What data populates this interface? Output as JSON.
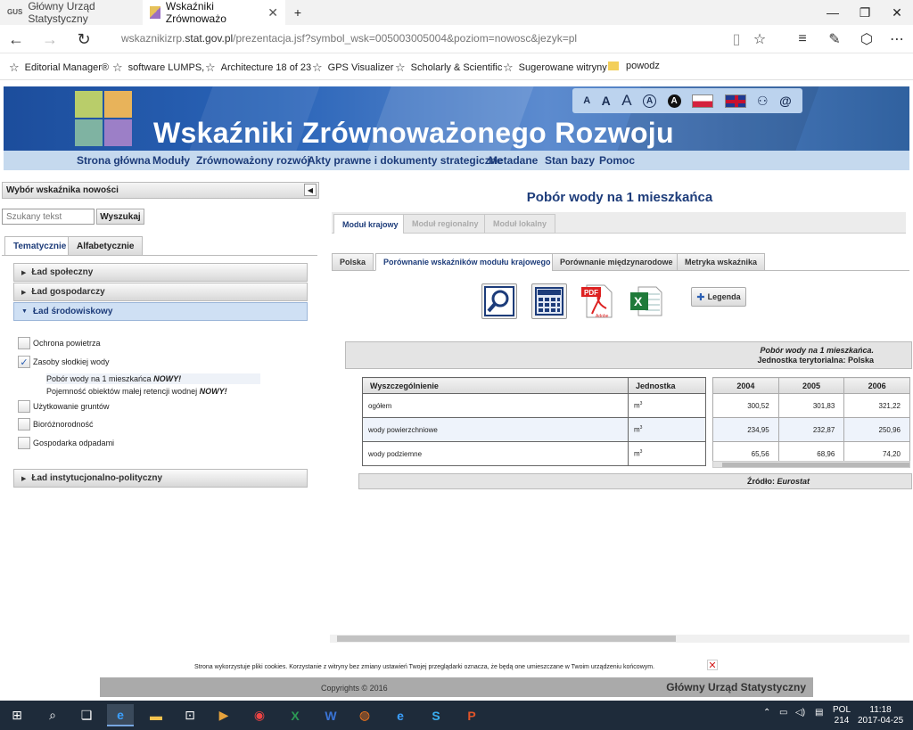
{
  "browser": {
    "tabs": [
      {
        "label": "Główny Urząd Statystyczny",
        "favicon": "GUS"
      },
      {
        "label": "Wskaźniki Zrównoważo",
        "favicon": "site"
      }
    ],
    "new_tab_icon": "+",
    "window": {
      "minimize": "—",
      "maximize": "❐",
      "close": "✕"
    },
    "url_prefix": "wskaznikizrp.",
    "url_domain": "stat.gov.pl",
    "url_rest": "/prezentacja.jsf?symbol_wsk=005003005004&poziom=nowosc&jezyk=pl",
    "favorites": [
      "Editorial Manager®",
      "software LUMPS,",
      "Architecture 18 of 23",
      "GPS Visualizer",
      "Scholarly & Scientific",
      "Sugerowane witryny",
      "powodz"
    ]
  },
  "site": {
    "title": "Wskaźniki Zrównoważonego Rozwoju",
    "access": [
      "A",
      "A",
      "A",
      "A",
      "A"
    ],
    "nav": [
      "Strona główna",
      "Moduły",
      "Zrównoważony rozwój",
      "Akty prawne i dokumenty strategiczne",
      "Metadane",
      "Stan bazy",
      "Pomoc"
    ]
  },
  "sidebar": {
    "panel_title": "Wybór wskaźnika nowości",
    "search_placeholder": "Szukany tekst",
    "search_button": "Wyszukaj",
    "tabs": [
      "Tematycznie",
      "Alfabetycznie"
    ],
    "groups": [
      "Ład społeczny",
      "Ład gospodarczy",
      "Ład środowiskowy",
      "Ład instytucjonalno-polityczny"
    ],
    "items": [
      {
        "label": "Ochrona powietrza",
        "checked": false
      },
      {
        "label": "Zasoby słodkiej wody",
        "checked": true
      },
      {
        "label": "Użytkowanie gruntów",
        "checked": false
      },
      {
        "label": "Bioróżnorodność",
        "checked": false
      },
      {
        "label": "Gospodarka odpadami",
        "checked": false
      }
    ],
    "sub_items": [
      {
        "label": "Pobór wody na 1 mieszkańca",
        "badge": "NOWY!"
      },
      {
        "label": "Pojemność obiektów małej retencji wodnej",
        "badge": "NOWY!"
      }
    ]
  },
  "main": {
    "title": "Pobór wody na 1 mieszkańca",
    "module_tabs": [
      "Moduł krajowy",
      "Moduł regionalny",
      "Moduł lokalny"
    ],
    "sub_tabs": [
      "Polska",
      "Porównanie wskaźników modułu krajowego",
      "Porównanie międzynarodowe",
      "Metryka wskaźnika"
    ],
    "legend_button": "Legenda",
    "caption_title": "Pobór wody na 1 mieszkańca.",
    "caption_sub": "Jednostka terytorialna: Polska",
    "table": {
      "col_label": "Wyszczególnienie",
      "col_unit": "Jednostka",
      "unit": "m",
      "unit_sup": "3",
      "years": [
        "2004",
        "2005",
        "2006"
      ],
      "rows": [
        {
          "label": "ogółem",
          "values": [
            "300,52",
            "301,83",
            "321,22"
          ]
        },
        {
          "label": "wody powierzchniowe",
          "values": [
            "234,95",
            "232,87",
            "250,96"
          ]
        },
        {
          "label": "wody podziemne",
          "values": [
            "65,56",
            "68,96",
            "74,20"
          ]
        }
      ]
    },
    "source_label": "Źródło:",
    "source_value": "Eurostat"
  },
  "footer": {
    "cookie_text": "Strona wykorzystuje pliki cookies. Korzystanie z witryny bez zmiany ustawień Twojej przeglądarki oznacza, że będą one umieszczane w Twoim urządzeniu końcowym.",
    "copyright": "Copyrights © 2016",
    "org": "Główny Urząd Statystyczny"
  },
  "taskbar": {
    "lang": "POL",
    "lang_sub": "214",
    "time": "11:18",
    "date": "2017-04-25"
  },
  "colors": {
    "brand_blue": "#1d3c7a",
    "header_blue": "#2a64b8",
    "nav_bg": "#c5d9ee"
  }
}
